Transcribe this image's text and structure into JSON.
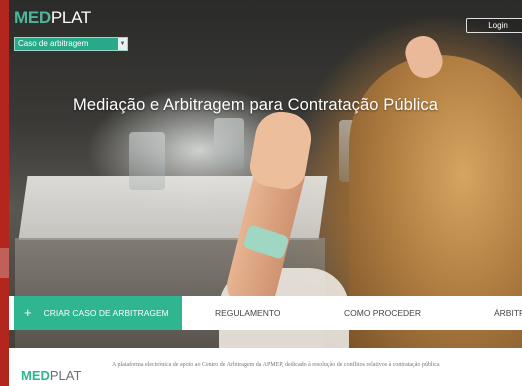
{
  "header": {
    "logo_part1": "MED",
    "logo_part2": "PLAT",
    "case_select_value": "Caso de arbitragem",
    "login_label": "Login"
  },
  "hero": {
    "title": "Mediação e Arbitragem para Contratação Pública"
  },
  "nav": {
    "cta_icon": "+",
    "cta_label": "CRIAR CASO DE ARBITRAGEM",
    "items": [
      "REGULAMENTO",
      "COMO PROCEDER",
      "ÁRBITR"
    ]
  },
  "footer": {
    "logo_part1": "MED",
    "logo_part2": "PLAT",
    "description": "A plataforma electrónica de apoio ao Centro de Arbitragem da APMEP, dedicado à resolução de conflitos relativos à contratação pública"
  },
  "colors": {
    "accent": "#2fb58f",
    "left_strip": "#b3261e"
  }
}
